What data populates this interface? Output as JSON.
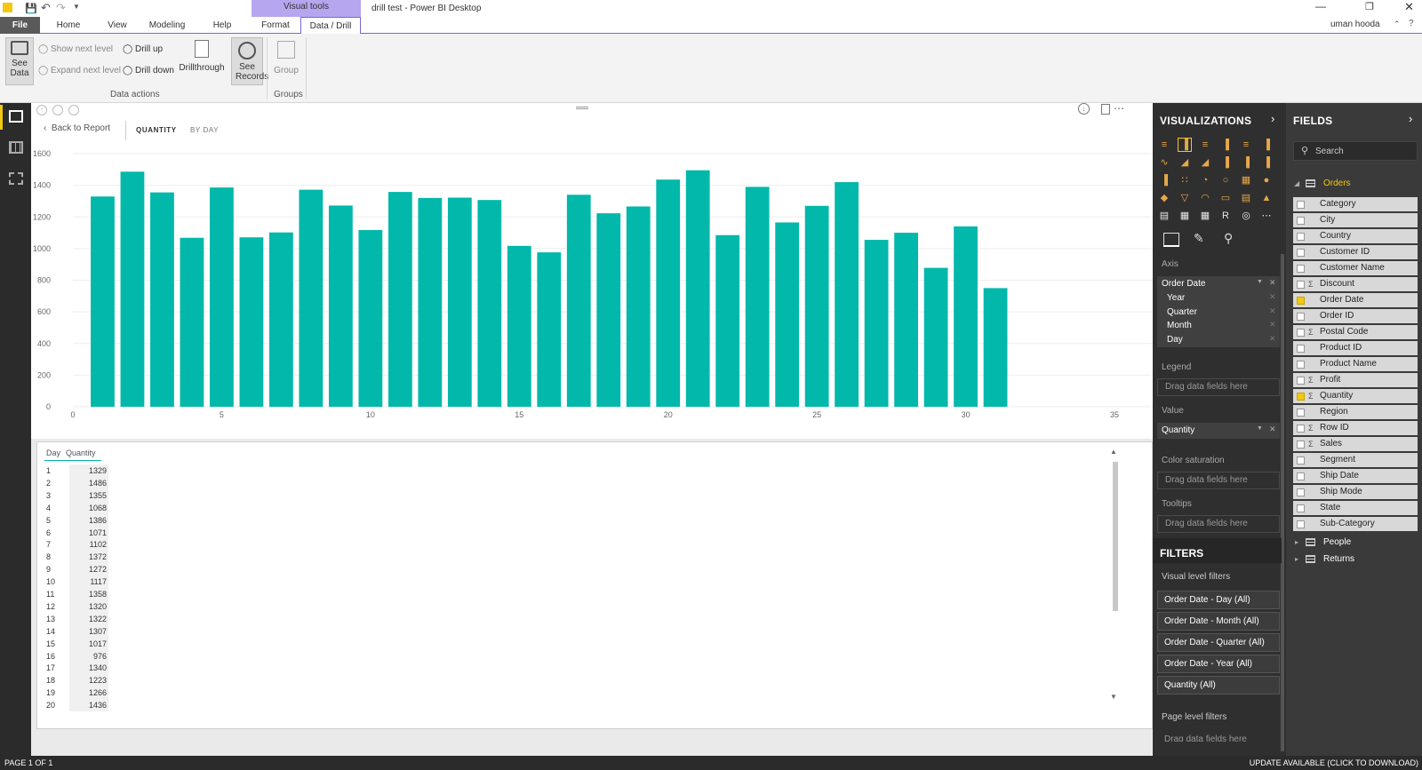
{
  "titlebar": {
    "doc_title": "drill test - Power BI Desktop",
    "user": "uman hooda",
    "visual_tools": "Visual tools"
  },
  "tabs": [
    "File",
    "Home",
    "View",
    "Modeling",
    "Help",
    "Format",
    "Data / Drill"
  ],
  "ribbon": {
    "see_data": "See Data",
    "show_next_level": "Show next level",
    "expand_next_level": "Expand next level",
    "drill_up": "Drill up",
    "drill_down": "Drill down",
    "drillthrough": "Drillthrough",
    "see_records": "See Records",
    "group": "Group",
    "group_data_actions": "Data actions",
    "group_groups": "Groups"
  },
  "visual_header": {
    "back": "Back to Report",
    "tab_quantity": "QUANTITY",
    "tab_byday": "BY DAY"
  },
  "chart_data": {
    "type": "bar",
    "x": [
      1,
      2,
      3,
      4,
      5,
      6,
      7,
      8,
      9,
      10,
      11,
      12,
      13,
      14,
      15,
      16,
      17,
      18,
      19,
      20,
      21,
      22,
      23,
      24,
      25,
      26,
      27,
      28,
      29,
      30,
      31
    ],
    "values": [
      1329,
      1486,
      1355,
      1068,
      1386,
      1071,
      1102,
      1372,
      1272,
      1117,
      1358,
      1320,
      1322,
      1307,
      1017,
      976,
      1340,
      1223,
      1266,
      1436,
      1495,
      1085,
      1390,
      1165,
      1270,
      1420,
      1055,
      1100,
      878,
      1140,
      750
    ],
    "xticks": [
      "0",
      "5",
      "10",
      "15",
      "20",
      "25",
      "30",
      "35"
    ],
    "yticks": [
      "0",
      "200",
      "400",
      "600",
      "800",
      "1000",
      "1200",
      "1400",
      "1600"
    ],
    "xlim": [
      0,
      35
    ],
    "ylim": [
      0,
      1600
    ],
    "color": "#01b8aa"
  },
  "table": {
    "headers": [
      "Day",
      "Quantity"
    ],
    "rows": [
      [
        "1",
        "1329"
      ],
      [
        "2",
        "1486"
      ],
      [
        "3",
        "1355"
      ],
      [
        "4",
        "1068"
      ],
      [
        "5",
        "1386"
      ],
      [
        "6",
        "1071"
      ],
      [
        "7",
        "1102"
      ],
      [
        "8",
        "1372"
      ],
      [
        "9",
        "1272"
      ],
      [
        "10",
        "1117"
      ],
      [
        "11",
        "1358"
      ],
      [
        "12",
        "1320"
      ],
      [
        "13",
        "1322"
      ],
      [
        "14",
        "1307"
      ],
      [
        "15",
        "1017"
      ],
      [
        "16",
        "976"
      ],
      [
        "17",
        "1340"
      ],
      [
        "18",
        "1223"
      ],
      [
        "19",
        "1266"
      ],
      [
        "20",
        "1436"
      ]
    ]
  },
  "viz": {
    "title": "VISUALIZATIONS",
    "axis_label": "Axis",
    "axis_field": "Order Date",
    "axis_sub": [
      "Year",
      "Quarter",
      "Month",
      "Day"
    ],
    "legend_label": "Legend",
    "value_label": "Value",
    "value_field": "Quantity",
    "color_sat_label": "Color saturation",
    "tooltips_label": "Tooltips",
    "drag": "Drag data fields here",
    "drag_cut": "Drag data fields here"
  },
  "filters": {
    "title": "FILTERS",
    "visual_level": "Visual level filters",
    "items": [
      "Order Date - Day (All)",
      "Order Date - Month (All)",
      "Order Date - Quarter (All)",
      "Order Date - Year (All)",
      "Quantity (All)"
    ],
    "page_level": "Page level filters"
  },
  "fields": {
    "title": "FIELDS",
    "search_placeholder": "Search",
    "table_orders": "Orders",
    "items": [
      {
        "name": "Category",
        "checked": false,
        "sigma": false
      },
      {
        "name": "City",
        "checked": false,
        "sigma": false
      },
      {
        "name": "Country",
        "checked": false,
        "sigma": false
      },
      {
        "name": "Customer ID",
        "checked": false,
        "sigma": false
      },
      {
        "name": "Customer Name",
        "checked": false,
        "sigma": false
      },
      {
        "name": "Discount",
        "checked": false,
        "sigma": true
      },
      {
        "name": "Order Date",
        "checked": true,
        "sigma": false
      },
      {
        "name": "Order ID",
        "checked": false,
        "sigma": false
      },
      {
        "name": "Postal Code",
        "checked": false,
        "sigma": true
      },
      {
        "name": "Product ID",
        "checked": false,
        "sigma": false
      },
      {
        "name": "Product Name",
        "checked": false,
        "sigma": false
      },
      {
        "name": "Profit",
        "checked": false,
        "sigma": true
      },
      {
        "name": "Quantity",
        "checked": true,
        "sigma": true
      },
      {
        "name": "Region",
        "checked": false,
        "sigma": false
      },
      {
        "name": "Row ID",
        "checked": false,
        "sigma": true
      },
      {
        "name": "Sales",
        "checked": false,
        "sigma": true
      },
      {
        "name": "Segment",
        "checked": false,
        "sigma": false
      },
      {
        "name": "Ship Date",
        "checked": false,
        "sigma": false
      },
      {
        "name": "Ship Mode",
        "checked": false,
        "sigma": false
      },
      {
        "name": "State",
        "checked": false,
        "sigma": false
      },
      {
        "name": "Sub-Category",
        "checked": false,
        "sigma": false
      }
    ],
    "table_people": "People",
    "table_returns": "Returns"
  },
  "status": {
    "page": "PAGE 1 OF 1",
    "update": "UPDATE AVAILABLE (CLICK TO DOWNLOAD)"
  }
}
